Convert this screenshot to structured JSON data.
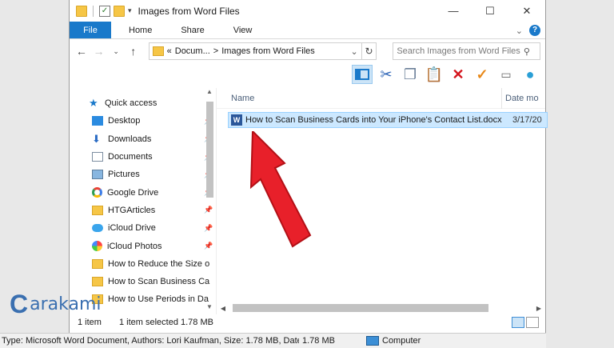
{
  "window": {
    "title": "Images from Word Files",
    "controls": {
      "minimize": "—",
      "maximize": "☐",
      "close": "✕"
    }
  },
  "ribbon": {
    "file": "File",
    "tabs": [
      "Home",
      "Share",
      "View"
    ],
    "help": "?"
  },
  "address": {
    "prefix": "«",
    "crumb1": "Docum...",
    "crumb2": "Images from Word Files",
    "sep": ">"
  },
  "search": {
    "placeholder": "Search Images from Word Files"
  },
  "nav": {
    "quick_access": "Quick access",
    "items": [
      {
        "label": "Desktop",
        "icon": "desktop-icon",
        "pinned": true
      },
      {
        "label": "Downloads",
        "icon": "downloads-icon",
        "pinned": true
      },
      {
        "label": "Documents",
        "icon": "documents-icon",
        "pinned": true
      },
      {
        "label": "Pictures",
        "icon": "pictures-icon",
        "pinned": true
      },
      {
        "label": "Google Drive",
        "icon": "google-drive-icon",
        "pinned": true
      },
      {
        "label": "HTGArticles",
        "icon": "folder-icon",
        "pinned": true
      },
      {
        "label": "iCloud Drive",
        "icon": "icloud-drive-icon",
        "pinned": true
      },
      {
        "label": "iCloud Photos",
        "icon": "icloud-photos-icon",
        "pinned": true
      },
      {
        "label": "How to Reduce the Size o",
        "icon": "folder-icon",
        "pinned": false
      },
      {
        "label": "How to Scan Business Ca",
        "icon": "folder-icon",
        "pinned": false
      },
      {
        "label": "How to Use Periods in Da",
        "icon": "folder-icon",
        "pinned": false
      }
    ]
  },
  "columns": {
    "name": "Name",
    "date": "Date mo"
  },
  "file": {
    "name": "How to Scan Business Cards into Your iPhone's Contact List.docx",
    "date": "3/17/20"
  },
  "status": {
    "count": "1 item",
    "selected": "1 item selected  1.78 MB"
  },
  "details": {
    "info": "Type: Microsoft Word Document, Authors: Lori Kaufman, Size: 1.78 MB, Date",
    "size": "1.78 MB",
    "location": "Computer"
  },
  "watermark": {
    "text": "arakami",
    "letter": "C"
  },
  "colors": {
    "accent": "#1979ca",
    "arrow": "#e8202a",
    "selection": "#cce8ff"
  }
}
